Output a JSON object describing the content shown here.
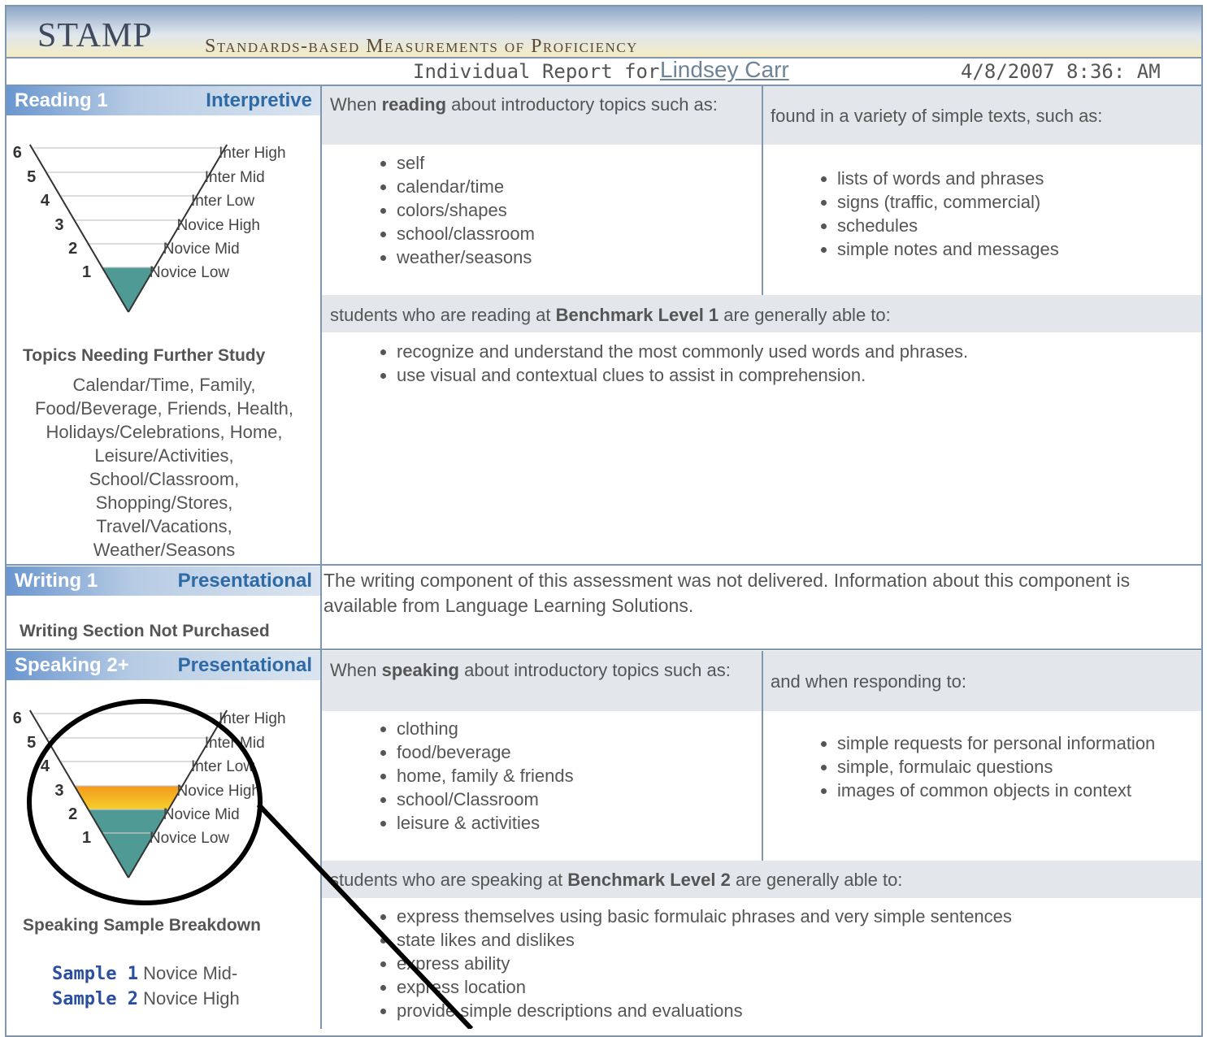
{
  "header": {
    "logo": "STAMP",
    "title": "Standards-based Measurements of Proficiency",
    "report_label": "Individual Report for",
    "student_name": "Lindsey Carr",
    "date": "4/8/2007 8:36: AM"
  },
  "scale": {
    "levels": [
      {
        "num": "6",
        "label": "Inter High"
      },
      {
        "num": "5",
        "label": "Inter Mid"
      },
      {
        "num": "4",
        "label": "Inter Low"
      },
      {
        "num": "3",
        "label": "Novice High"
      },
      {
        "num": "2",
        "label": "Novice Mid"
      },
      {
        "num": "1",
        "label": "Novice Low"
      }
    ]
  },
  "reading": {
    "name": "Reading 1",
    "mode": "Interpretive",
    "level": 1,
    "fill_color": "#4f9a94",
    "topics_head_pre": "When ",
    "topics_head_bold": "reading",
    "topics_head_post": " about introductory topics such as:",
    "texts_head": "found in a variety of simple texts, such as:",
    "topics": [
      "self",
      "calendar/time",
      "colors/shapes",
      "school/classroom",
      "weather/seasons"
    ],
    "texts": [
      "lists of words and phrases",
      "signs (traffic, commercial)",
      "schedules",
      "simple notes and messages"
    ],
    "benchmark_pre": "students who are reading at ",
    "benchmark_bold": "Benchmark Level 1",
    "benchmark_post": " are generally able to:",
    "abilities": [
      "recognize and understand the most commonly used words and phrases.",
      "use visual and contextual clues to assist in comprehension."
    ],
    "further_study_title": "Topics Needing Further Study",
    "further_study_lines": [
      "Calendar/Time, Family,",
      "Food/Beverage, Friends, Health,",
      "Holidays/Celebrations, Home,",
      "Leisure/Activities,",
      "School/Classroom,",
      "Shopping/Stores,",
      "Travel/Vacations,",
      "Weather/Seasons"
    ]
  },
  "writing": {
    "name": "Writing 1",
    "mode": "Presentational",
    "status": "Writing Section Not Purchased",
    "message": "The writing component of this assessment was not delivered. Information about this component is available from Language Learning Solutions."
  },
  "speaking": {
    "name": "Speaking 2+",
    "mode": "Presentational",
    "level_colors": {
      "base": "#4f9a94",
      "top_start": "#f39a1e",
      "top_end": "#f7cf2a"
    },
    "topics_head_pre": "When ",
    "topics_head_bold": "speaking",
    "topics_head_post": " about  introductory topics such as:",
    "responding_head": "and when responding to:",
    "topics": [
      "clothing",
      "food/beverage",
      "home, family & friends",
      "school/Classroom",
      "leisure & activities"
    ],
    "responding": [
      "simple requests for personal information",
      "simple, formulaic questions",
      "images of common objects in context"
    ],
    "benchmark_pre": "students who are speaking at ",
    "benchmark_bold": "Benchmark Level 2",
    "benchmark_post": " are generally able to:",
    "abilities": [
      "express themselves using basic formulaic phrases and very simple sentences",
      "state likes and dislikes",
      "express ability",
      "express location",
      "provide simple descriptions and evaluations"
    ],
    "breakdown_title": "Speaking Sample Breakdown",
    "samples": [
      {
        "label": "Sample 1",
        "value": "Novice Mid-"
      },
      {
        "label": "Sample 2",
        "value": "Novice High"
      }
    ]
  }
}
